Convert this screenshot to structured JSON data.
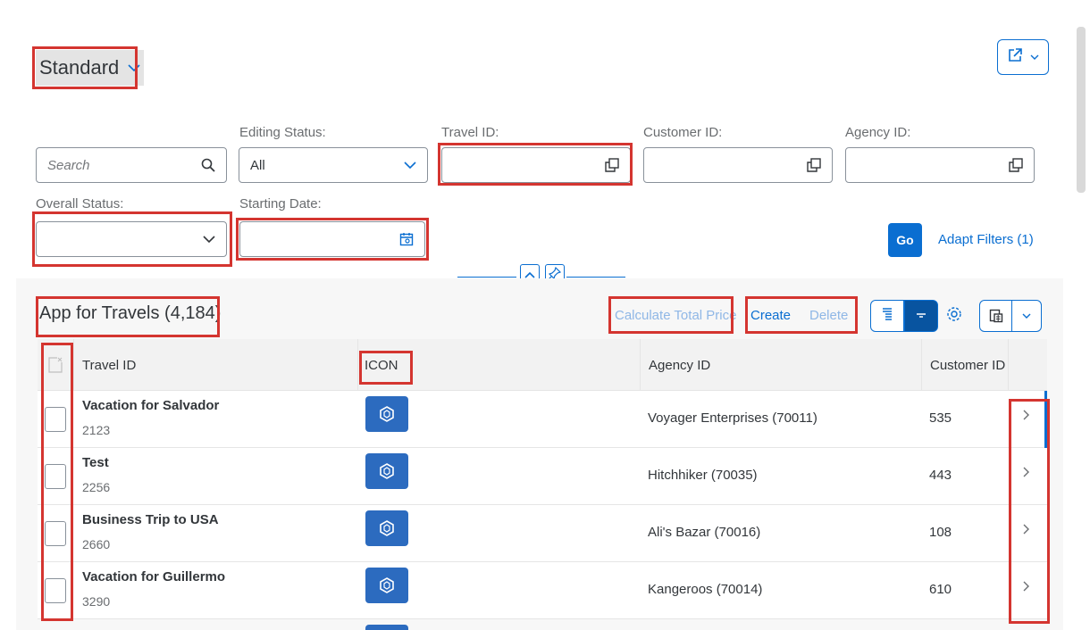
{
  "variant": {
    "title": "Standard"
  },
  "header": {
    "share_icon": "share-icon"
  },
  "filters": {
    "search_placeholder": "Search",
    "editing_status_label": "Editing Status:",
    "editing_status_value": "All",
    "travel_id_label": "Travel ID:",
    "customer_id_label": "Customer ID:",
    "agency_id_label": "Agency ID:",
    "overall_status_label": "Overall Status:",
    "starting_date_label": "Starting Date:",
    "go_label": "Go",
    "adapt_label": "Adapt Filters (1)"
  },
  "table": {
    "title": "App for Travels (4,184)",
    "toolbar": {
      "calculate_label": "Calculate Total Price",
      "create_label": "Create",
      "delete_label": "Delete"
    },
    "columns": {
      "travel_id": "Travel ID",
      "icon": "ICON",
      "agency_id": "Agency ID",
      "customer_id": "Customer ID"
    },
    "rows": [
      {
        "title": "Vacation for Salvador",
        "id": "2123",
        "agency": "Voyager Enterprises (70011)",
        "customer": "535"
      },
      {
        "title": "Test",
        "id": "2256",
        "agency": "Hitchhiker (70035)",
        "customer": "443"
      },
      {
        "title": "Business Trip to USA",
        "id": "2660",
        "agency": "Ali's Bazar (70016)",
        "customer": "108"
      },
      {
        "title": "Vacation for Guillermo",
        "id": "3290",
        "agency": "Kangeroos (70014)",
        "customer": "610"
      }
    ]
  },
  "colors": {
    "accent": "#0a6ed1",
    "highlight": "#d43530",
    "icon_bg": "#2c6bbf"
  }
}
